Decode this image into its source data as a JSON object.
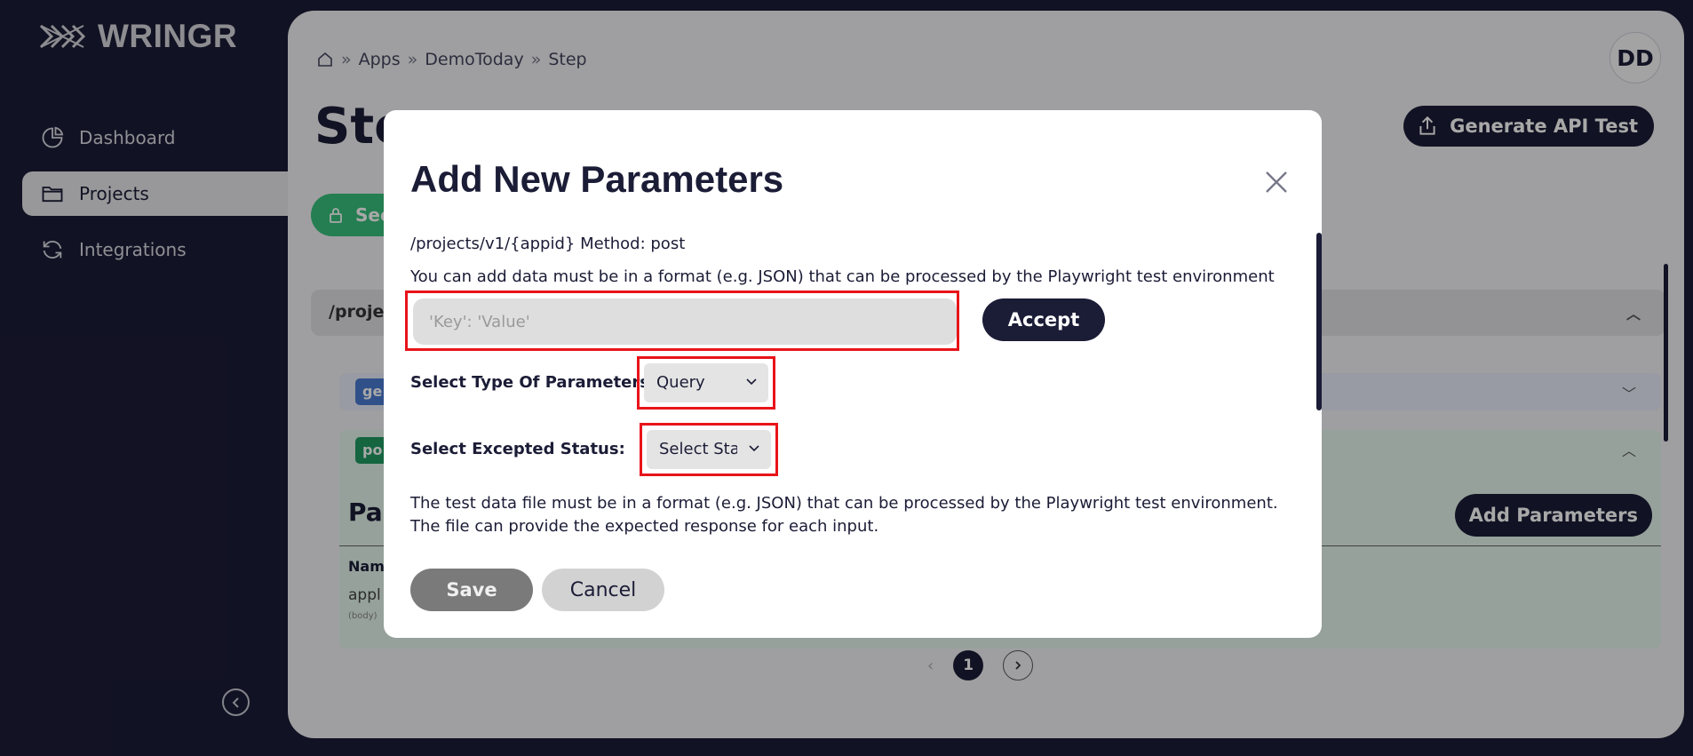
{
  "app": {
    "logo_text": "WRINGR"
  },
  "sidebar": {
    "items": [
      {
        "label": "Dashboard",
        "icon": "pie-chart-icon"
      },
      {
        "label": "Projects",
        "icon": "folder-icon",
        "active": true
      },
      {
        "label": "Integrations",
        "icon": "refresh-icon"
      }
    ]
  },
  "header": {
    "breadcrumb": [
      "Apps",
      "DemoToday",
      "Step"
    ],
    "avatar": "DD",
    "page_title": "Step",
    "generate_button": "Generate API Test"
  },
  "background": {
    "security_badge": "Sec",
    "endpoint_path": "/project",
    "get_badge": "ge",
    "post_badge": "po",
    "params_title": "Par",
    "add_params_button": "Add Parameters",
    "table_header": "Nam",
    "table_value": "appl",
    "table_sub": "(body)",
    "page_number": "1"
  },
  "modal": {
    "title": "Add New Parameters",
    "path_line": "/projects/v1/{appid} Method: post",
    "hint": "You can add data must be in a format (e.g. JSON) that can be processed by the Playwright test environment",
    "kv_placeholder": "'Key': 'Value'",
    "accept_button": "Accept",
    "type_label": "Select Type Of Parameters:",
    "type_value": "Query",
    "status_label": "Select Excepted Status:",
    "status_value": "Select Sta",
    "note": "The test data file must be in a format (e.g. JSON) that can be processed by the Playwright test environment. The file can provide the expected response for each input.",
    "save_button": "Save",
    "cancel_button": "Cancel"
  },
  "colors": {
    "navy": "#1b1c36",
    "highlight": "#e8141a",
    "green": "#37c07b"
  }
}
